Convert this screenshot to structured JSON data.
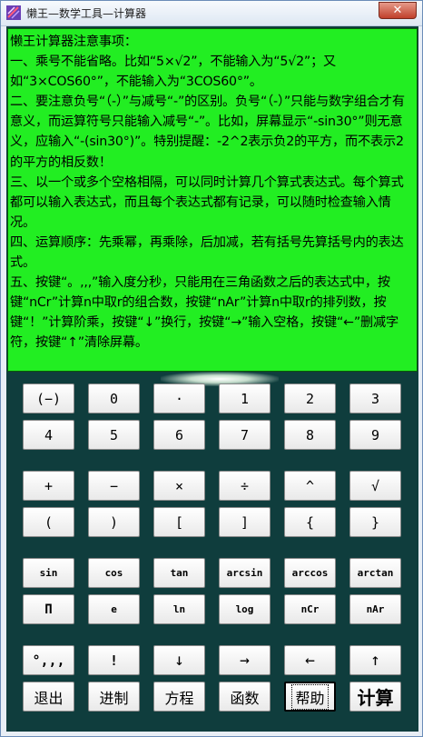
{
  "window": {
    "title": "懒王—数学工具—计算器",
    "close_label": "✕"
  },
  "notes": [
    "懒王计算器注意事项：",
    "一、乘号不能省略。比如“5×√2”，不能输入为“5√2”；又如“3×COS60°”，不能输入为“3COS60°”。",
    "二、要注意负号“（-）”与减号“-”的区别。负号“（-）”只能与数字组合才有意义，而运算符号只能输入减号“-”。比如，屏幕显示“-sin30°”则无意义，应输入“-(sin30°)”。特别提醒：-2^2表示负2的平方，而不表示2的平方的相反数！",
    "三、以一个或多个空格相隔，可以同时计算几个算式表达式。每个算式都可以输入表达式，而且每个表达式都有记录，可以随时检查输入情况。",
    "四、运算顺序：先乘幂，再乘除，后加减，若有括号先算括号内的表达式。",
    "五、按键“。,,,”输入度分秒，只能用在三角函数之后的表达式中，按键“nCr”计算n中取r的组合数，按键“nAr”计算n中取r的排列数，按键“！”计算阶乘，按键“↓”换行，按键“→”输入空格，按键“←”删减字符，按键“↑”清除屏幕。"
  ],
  "keys": {
    "neg": "(−)",
    "d0": "0",
    "dot": "·",
    "d1": "1",
    "d2": "2",
    "d3": "3",
    "d4": "4",
    "d5": "5",
    "d6": "6",
    "d7": "7",
    "d8": "8",
    "d9": "9",
    "plus": "+",
    "minus": "−",
    "times": "×",
    "divide": "÷",
    "power": "^",
    "sqrt": "√",
    "lparen": "(",
    "rparen": ")",
    "lbracket": "[",
    "rbracket": "]",
    "lbrace": "{",
    "rbrace": "}",
    "sin": "sin",
    "cos": "cos",
    "tan": "tan",
    "arcsin": "arcsin",
    "arccos": "arccos",
    "arctan": "arctan",
    "pi": "Π",
    "e": "e",
    "ln": "ln",
    "log": "log",
    "ncr": "nCr",
    "nar": "nAr",
    "dms": "°,,,",
    "factorial": "!",
    "down": "↓",
    "right": "→",
    "left": "←",
    "up": "↑",
    "exit": "退出",
    "base": "进制",
    "equation": "方程",
    "function": "函数",
    "help": "帮助",
    "calc": "计算"
  }
}
